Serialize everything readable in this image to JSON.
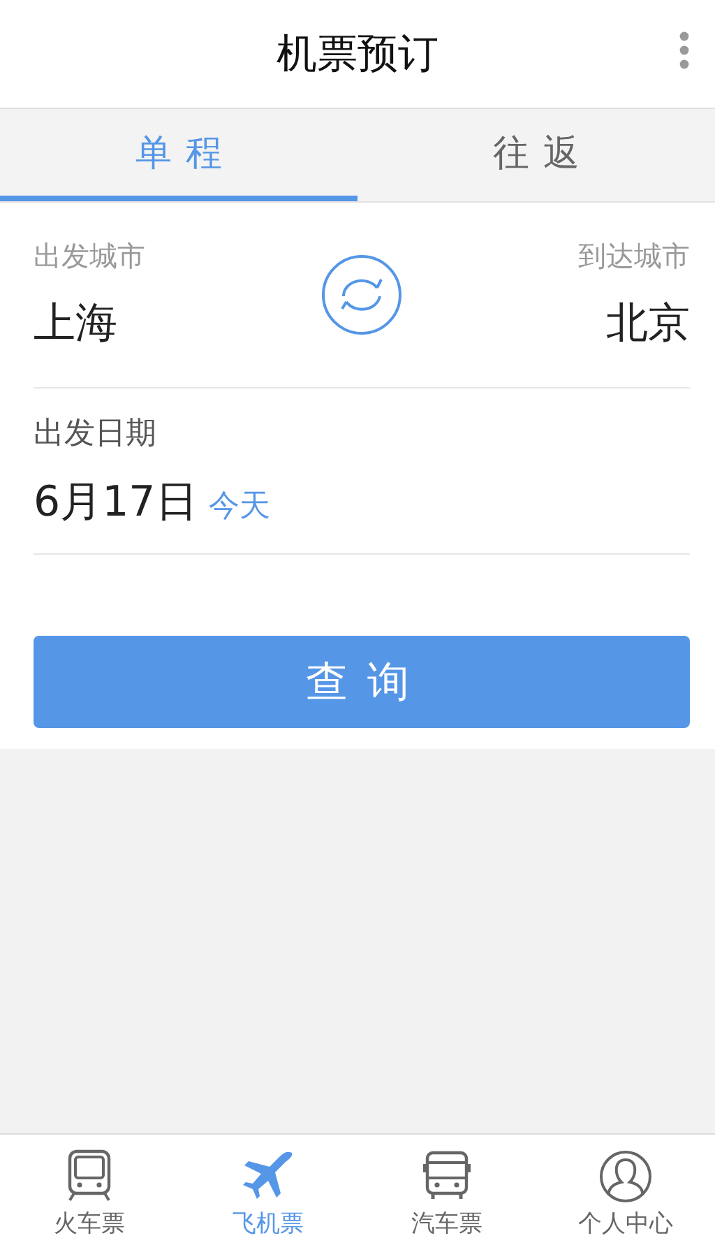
{
  "header": {
    "title": "机票预订"
  },
  "tabs": [
    {
      "label": "单程",
      "selected": true
    },
    {
      "label": "往返",
      "selected": false
    }
  ],
  "route": {
    "from_label": "出发城市",
    "from_city": "上海",
    "to_label": "到达城市",
    "to_city": "北京"
  },
  "date": {
    "label": "出发日期",
    "value": "6月17日",
    "note": "今天"
  },
  "search_button": "查询",
  "bottom_nav": [
    {
      "label": "火车票",
      "selected": false
    },
    {
      "label": "飞机票",
      "selected": true
    },
    {
      "label": "汽车票",
      "selected": false
    },
    {
      "label": "个人中心",
      "selected": false
    }
  ]
}
